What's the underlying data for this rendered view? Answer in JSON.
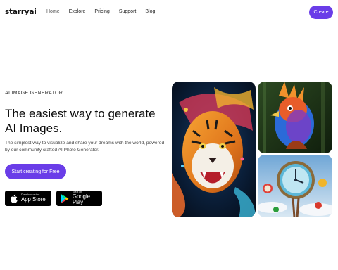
{
  "header": {
    "logo": "starryai",
    "nav": [
      "Home",
      "Explore",
      "Pricing",
      "Support",
      "Blog"
    ],
    "create_label": "Create"
  },
  "hero": {
    "eyebrow": "AI IMAGE GENERATOR",
    "headline": "The easiest way to generate AI Images.",
    "subtext": "The simplest way to visualize and share your dreams with the world, powered by our community crafted AI Photo Generator.",
    "cta_label": "Start creating for Free"
  },
  "stores": {
    "apple": {
      "small": "Download on the",
      "big": "App Store",
      "icon": "apple-icon"
    },
    "google": {
      "small": "Get it on",
      "big": "Google Play",
      "icon": "google-play-icon"
    }
  },
  "gallery": [
    {
      "name": "tiger-artwork",
      "subject": "colorful tiger"
    },
    {
      "name": "bird-artwork",
      "subject": "crested bird"
    },
    {
      "name": "clock-artwork",
      "subject": "surreal clock"
    }
  ],
  "colors": {
    "accent": "#6a3de8",
    "store_bg": "#000000"
  }
}
